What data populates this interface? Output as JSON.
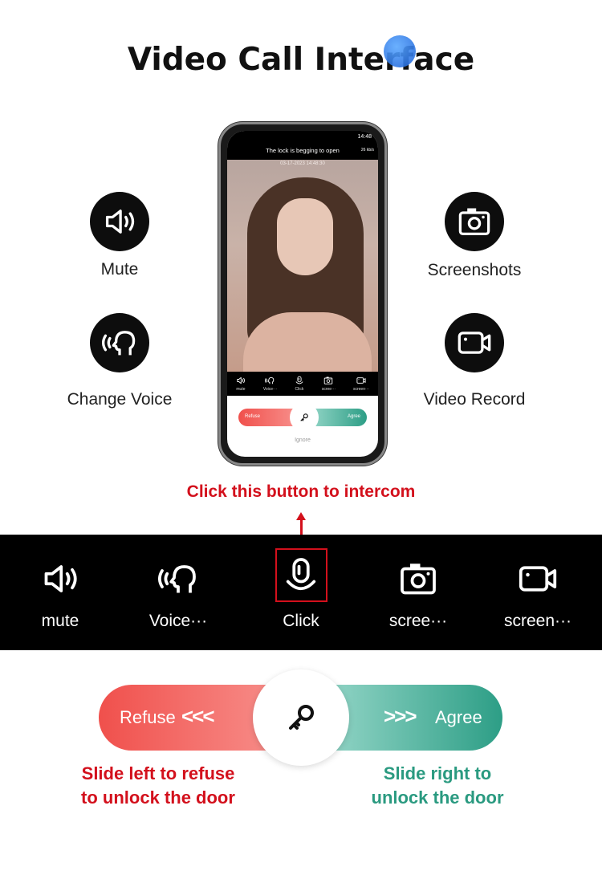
{
  "title": "Video Call Interface",
  "features": {
    "mute": "Mute",
    "change_voice": "Change Voice",
    "screenshots": "Screenshots",
    "video_record": "Video Record"
  },
  "phone": {
    "status_time": "14:48",
    "status_title": "The lock is begging to open",
    "speed": "26 kb/s",
    "timestamp": "03-17-2023  14:48:30",
    "toolbar": [
      "mute",
      "Voice···",
      "Click",
      "scree···",
      "screen···"
    ],
    "refuse": "Refuse",
    "agree": "Agree",
    "ignore": "Ignore"
  },
  "callout": "Click this button to intercom",
  "toolbar": {
    "items": [
      {
        "label": "mute",
        "icon": "speaker-icon"
      },
      {
        "label": "Voice···",
        "icon": "voice-change-icon"
      },
      {
        "label": "Click",
        "icon": "microphone-icon"
      },
      {
        "label": "scree···",
        "icon": "camera-icon"
      },
      {
        "label": "screen···",
        "icon": "video-camera-icon"
      }
    ]
  },
  "slider": {
    "refuse": "Refuse",
    "agree": "Agree",
    "left_arrows": "<<<",
    "right_arrows": ">>>"
  },
  "captions": {
    "left": [
      "Slide left to refuse",
      "to unlock the door"
    ],
    "right": [
      "Slide right to",
      "unlock the door"
    ]
  },
  "colors": {
    "red": "#d3101c",
    "green": "#2a9a80",
    "band": "#000000"
  }
}
